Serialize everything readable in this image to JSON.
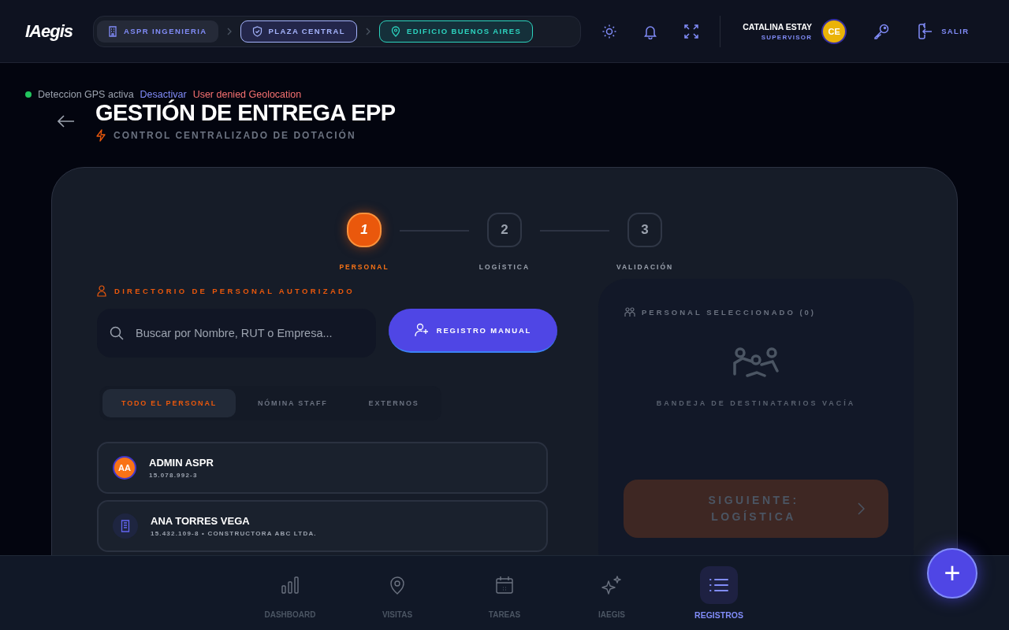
{
  "header": {
    "logo": "IAegis",
    "breadcrumbs": [
      {
        "kind": "building",
        "label": "ASPR INGENIERIA"
      },
      {
        "kind": "shield",
        "label": "PLAZA CENTRAL"
      },
      {
        "kind": "pin",
        "label": "EDIFICIO BUENOS AIRES"
      }
    ],
    "user": {
      "name": "CATALINA ESTAY",
      "role": "SUPERVISOR",
      "initials": "CE"
    },
    "logout": "SALIR"
  },
  "gps": {
    "status": "Deteccion GPS activa",
    "active": true,
    "action": "Desactivar",
    "error": "User denied Geolocation"
  },
  "page": {
    "title": "GESTIÓN DE ENTREGA EPP",
    "subtitle": "CONTROL CENTRALIZADO DE DOTACIÓN"
  },
  "steps": [
    {
      "number": "1",
      "label": "PERSONAL",
      "selected": true
    },
    {
      "number": "2",
      "label": "LOGÍSTICA",
      "selected": false
    },
    {
      "number": "3",
      "label": "VALIDACIÓN",
      "selected": false
    }
  ],
  "directory": {
    "title": "DIRECTORIO DE PERSONAL AUTORIZADO",
    "search": {
      "placeholder": "Buscar por Nombre, RUT o Empresa..."
    },
    "manual_button": "REGISTRO MANUAL",
    "filters": [
      {
        "label": "TODO EL PERSONAL",
        "selected": true
      },
      {
        "label": "NÓMINA STAFF",
        "selected": false
      },
      {
        "label": "EXTERNOS",
        "selected": false
      }
    ],
    "people": [
      {
        "kind": "initials",
        "initials": "AA",
        "name": "ADMIN ASPR",
        "detail": "15.078.992-3"
      },
      {
        "kind": "company",
        "name": "ANA TORRES VEGA",
        "detail": "15.432.109-8 • CONSTRUCTORA ABC LTDA."
      }
    ]
  },
  "selection": {
    "title": "PERSONAL SELECCIONADO (0)",
    "empty": "BANDEJA DE DESTINATARIOS VACÍA",
    "next_button": "SIGUIENTE: LOGÍSTICA",
    "next_disabled": true
  },
  "bottom_nav": [
    {
      "kind": "chart",
      "label": "DASHBOARD",
      "selected": false
    },
    {
      "kind": "pin",
      "label": "VISITAS",
      "selected": false
    },
    {
      "kind": "calendar",
      "label": "TAREAS",
      "selected": false
    },
    {
      "kind": "sparkle",
      "label": "IAEGIS",
      "selected": false
    },
    {
      "kind": "list",
      "label": "REGISTROS",
      "selected": true
    }
  ],
  "fab": "+"
}
